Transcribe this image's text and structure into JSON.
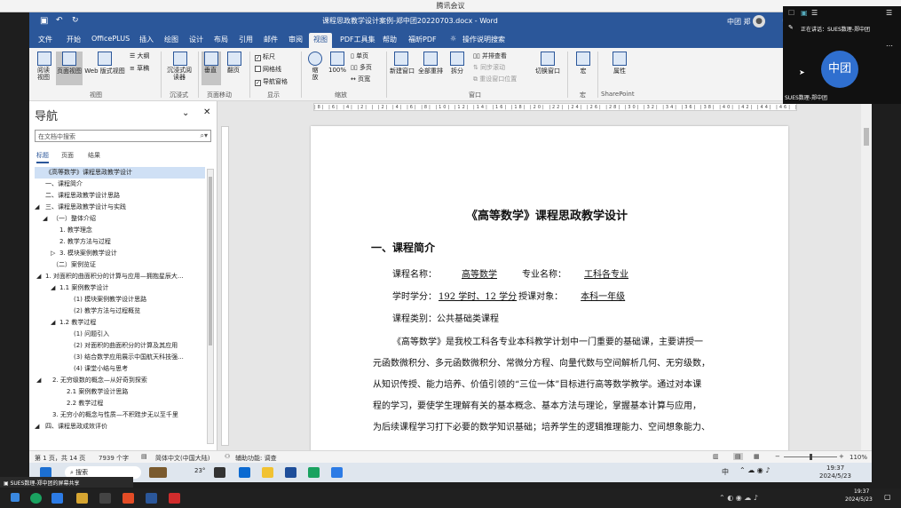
{
  "meeting": {
    "title": "腾讯会议",
    "speaking": "正在讲话：SUES数理-郑中团",
    "avatar_text": "中团",
    "participant": "SUES数理-郑中团",
    "share_notice": "SUES数理-郑中团的屏幕共享"
  },
  "word": {
    "doc_title": "课程思政教学设计案例-郑中团20220703.docx  -  Word",
    "user": "中团 郑",
    "tabs": [
      "文件",
      "开始",
      "OfficePLUS",
      "插入",
      "绘图",
      "设计",
      "布局",
      "引用",
      "邮件",
      "审阅",
      "视图",
      "PDF工具集",
      "帮助",
      "福昕PDF",
      "操作说明搜索"
    ],
    "active_tab": "视图",
    "ribbon": {
      "read_mode": "阅读视图",
      "print_layout": "页面视图",
      "web_layout": "Web 版式视图",
      "outline": "大纲",
      "draft": "草稿",
      "group_views": "视图",
      "immersive_reader": "沉浸式阅读器",
      "group_immersive": "沉浸式",
      "vertical": "垂直",
      "side_to_side": "翻页",
      "group_page_move": "页面移动",
      "ruler": "标尺",
      "gridlines": "网格线",
      "nav_pane": "导航窗格",
      "group_show": "显示",
      "zoom": "缩放",
      "zoom100": "100%",
      "one_page": "单页",
      "multi_page": "多页",
      "page_width": "页宽",
      "group_zoom": "缩放",
      "new_window": "新建窗口",
      "arrange_all": "全部重排",
      "split": "拆分",
      "side_by_side": "并排查看",
      "sync_scroll": "同步滚动",
      "reset_pos": "重设窗口位置",
      "switch_windows": "切换窗口",
      "group_window": "窗口",
      "macros": "宏",
      "group_macros": "宏",
      "properties": "属性",
      "group_sharepoint": "SharePoint"
    },
    "nav": {
      "title": "导航",
      "search_placeholder": "在文档中搜索",
      "tabs": [
        "标题",
        "页面",
        "结果"
      ],
      "items": [
        "《高等数学》课程思政教学设计",
        "一、课程简介",
        "二、课程思政教学设计思路",
        "三、课程思政教学设计与实践",
        "（一）整体介绍",
        "1. 教学理念",
        "2. 教学方法与过程",
        "3. 模块案例教学设计",
        "（二）案例览证",
        "1. 对面积的曲面积分的计算与应用—拥抱星辰大...",
        "1.1 案例教学设计",
        "(1) 模块案例教学设计思路",
        "(2) 教学方法与过程概览",
        "1.2 教学过程",
        "(1) 问题引入",
        "(2) 对面积的曲面积分的计算及其应用",
        "(3) 结合数学应用展示中国航天科技强...",
        "(4) 课堂小结与思考",
        "2. 无穷级数的概念—从好奇到探索",
        "2.1 案例教学设计思路",
        "2.2 教学过程",
        "3. 无穷小的概念与性质—不积跬步无以至千里",
        "四、课程思政成效评价"
      ]
    },
    "ruler_text": "|8| |6| |4| |2| | |2| |4| |6| |8| |10| |12| |14| |16| |18| |20| |22| |24| |26| |28| |30| |32| |34| |36| |38| |40| |42| |44| |46| |48|",
    "document": {
      "title": "《高等数学》课程思政教学设计",
      "section1": "一、课程简介",
      "course_name_label": "课程名称：",
      "course_name": "高等数学",
      "major_label": "专业名称：",
      "major": "工科各专业",
      "hours_label": "学时学分：",
      "hours": "192 学时、12 学分",
      "target_label": "授课对象：",
      "target": "本科一年级",
      "category": "课程类别：公共基础类课程",
      "para1": "《高等数学》是我校工科各专业本科教学计划中一门重要的基础课，主要讲授一",
      "para2": "元函数微积分、多元函数微积分、常微分方程、向量代数与空间解析几何、无穷级数，",
      "para3": "从知识传授、能力培养、价值引领的“三位一体”目标进行高等数学教学。通过对本课",
      "para4": "程的学习，要使学生理解有关的基本概念、基本方法与理论，掌握基本计算与应用，",
      "para5": "为后续课程学习打下必要的数学知识基础；培养学生的逻辑推理能力、空间想象能力、"
    },
    "status": {
      "page": "第 1 页，共 14 页",
      "words": "7939 个字",
      "language": "简体中文(中国大陆)",
      "accessibility": "辅助功能: 调查",
      "zoom": "110%"
    }
  },
  "taskbar": {
    "search": "搜索",
    "weather": "23°",
    "time": "19:37",
    "date": "2024/5/23"
  }
}
